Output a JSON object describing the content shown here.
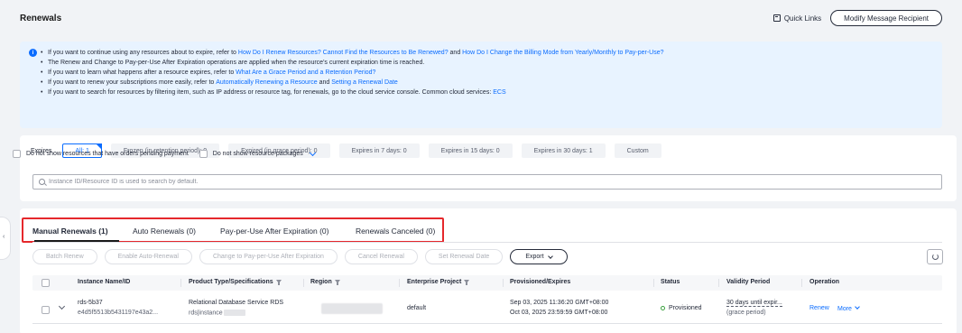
{
  "header": {
    "title": "Renewals",
    "quick_links": "Quick Links",
    "modify_recipient": "Modify Message Recipient"
  },
  "info": {
    "line1": {
      "text1": "If you want to continue using any resources about to expire, refer to ",
      "link1": "How Do I Renew Resources? Cannot Find the Resources to Be Renewed?",
      "text2": " and ",
      "link2": "How Do I Change the Billing Mode from Yearly/Monthly to Pay-per-Use?"
    },
    "line2": "The Renew and Change to Pay-per-Use After Expiration operations are applied when the resource's current expiration time is reached.",
    "line3": {
      "text1": "If you want to learn what happens after a resource expires, refer to ",
      "link1": "What Are a Grace Period and a Retention Period?"
    },
    "line4": {
      "text1": "If you want to renew your subscriptions more easily, refer to ",
      "link1": "Automatically Renewing a Resource",
      "text2": " and ",
      "link2": "Setting a Renewal Date"
    },
    "line5": {
      "text1": "If you want to search for resources by filtering item, such as IP address or resource tag, for renewals, go to the cloud service console. Common cloud services: ",
      "link1": "ECS"
    }
  },
  "filters": {
    "expires_label": "Expires",
    "chips": [
      "All: 1",
      "Frozen (in retention period): 0",
      "Expired (in grace period): 0",
      "Expires in 7 days: 0",
      "Expires in 15 days: 0",
      "Expires in 30 days: 1",
      "Custom"
    ],
    "check_pending": "Do not show resources that have orders pending payment",
    "check_packages": "Do not show resource packages",
    "search_placeholder": "Instance ID/Resource ID is used to search by default."
  },
  "tabs": [
    "Manual Renewals (1)",
    "Auto Renewals (0)",
    "Pay-per-Use After Expiration (0)",
    "Renewals Canceled (0)"
  ],
  "actions": {
    "batch_renew": "Batch Renew",
    "enable_auto": "Enable Auto-Renewal",
    "change_ppu": "Change to Pay-per-Use After Expiration",
    "cancel_renewal": "Cancel Renewal",
    "set_date": "Set Renewal Date",
    "export": "Export"
  },
  "table": {
    "columns": [
      "Instance Name/ID",
      "Product Type/Specifications",
      "Region",
      "Enterprise Project",
      "Provisioned/Expires",
      "Status",
      "Validity Period",
      "Operation"
    ],
    "rows": [
      {
        "name": "rds-5b37",
        "id": "e4d5f5513b5431197e43a2...",
        "product": "Relational Database Service RDS",
        "spec": "rds|instance",
        "project": "default",
        "provisioned": "Sep 03, 2025 11:36:20 GMT+08:00",
        "expires": "Oct 03, 2025 23:59:59 GMT+08:00",
        "status": "Provisioned",
        "validity": "30 days until expir...",
        "validity_sub": "(grace period)",
        "renew": "Renew",
        "more": "More"
      }
    ]
  },
  "colors": {
    "primary": "#0a6cff",
    "highlight": "#e5282c",
    "status_ok": "#3ba13f"
  }
}
